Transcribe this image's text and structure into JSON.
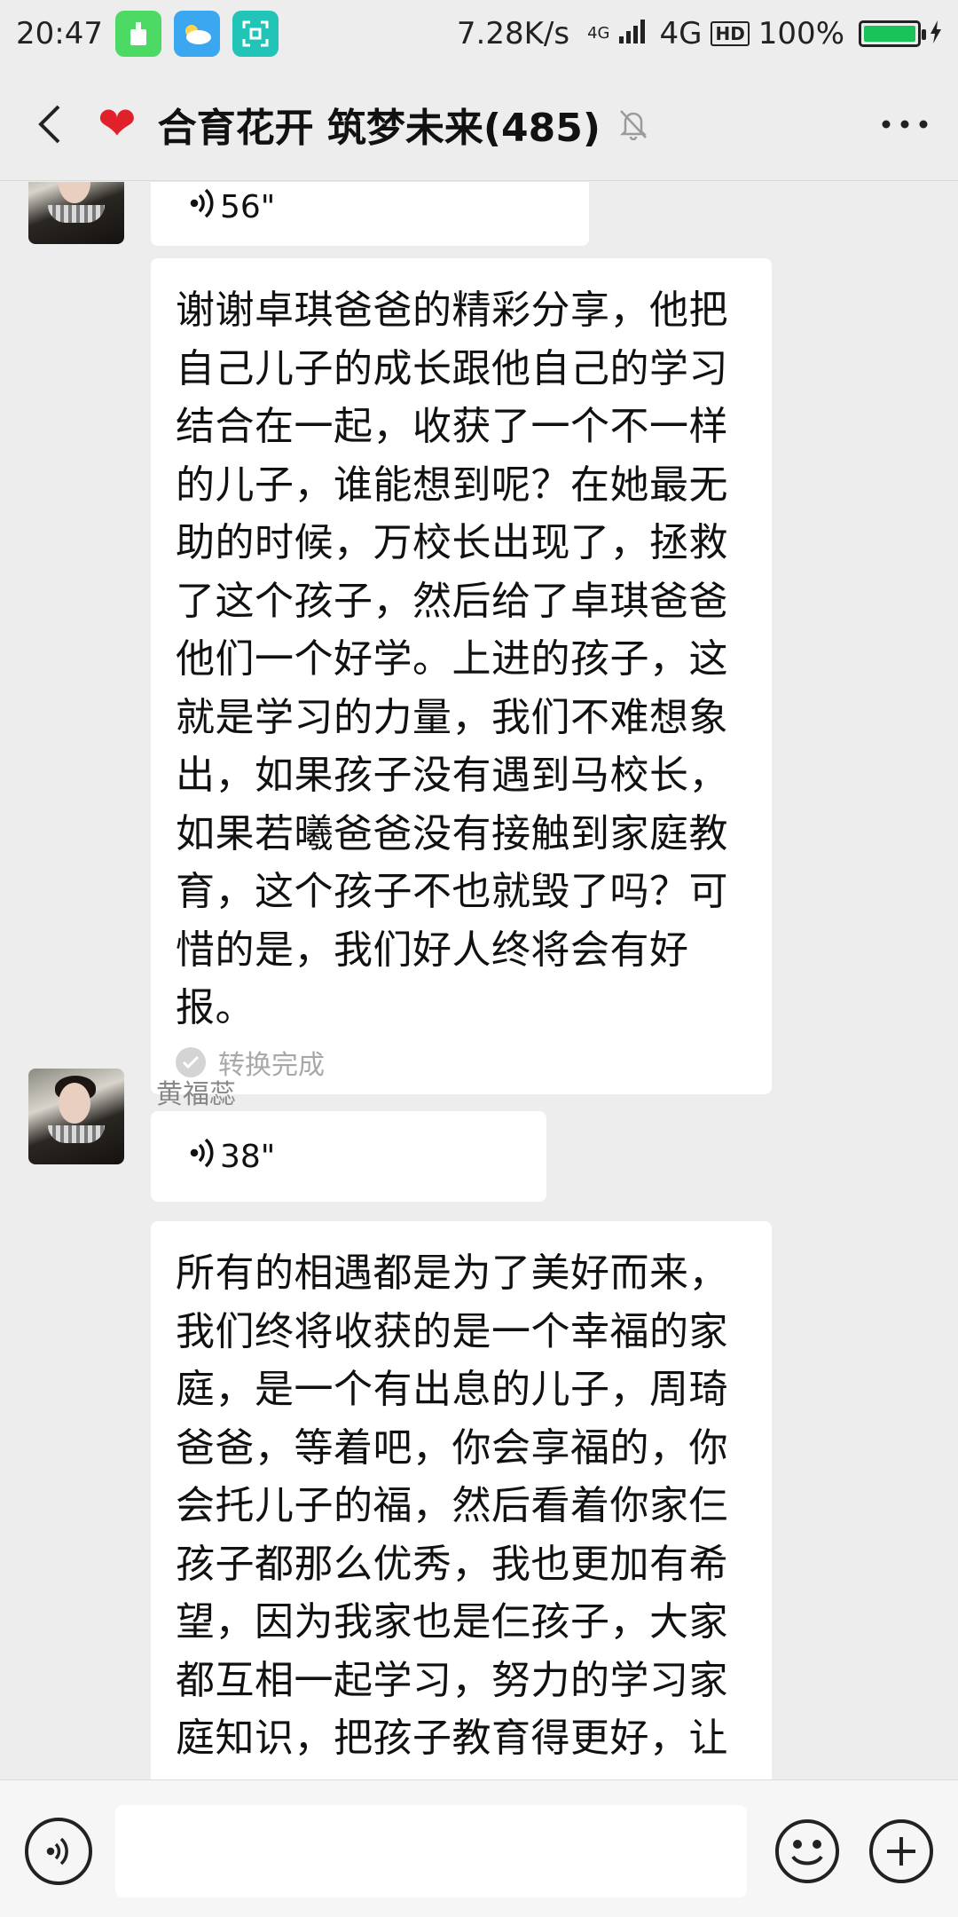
{
  "status_bar": {
    "time": "20:47",
    "net_speed": "7.28K/s",
    "network_small": "4G",
    "network": "4G",
    "hd": "HD",
    "battery": "100%",
    "battery_level": 1.0,
    "app_icons": [
      "cleaner-icon",
      "weather-icon",
      "scan-icon"
    ]
  },
  "header": {
    "title": "合育花开 筑梦未来(485)",
    "icons": [
      "back-arrow-icon",
      "heart-icon",
      "mute-bell-icon",
      "more-icon"
    ],
    "heart": "❤"
  },
  "messages": [
    {
      "type": "voice",
      "duration": "56\""
    },
    {
      "type": "text",
      "text": "谢谢卓琪爸爸的精彩分享，他把自己儿子的成长跟他自己的学习结合在一起，收获了一个不一样的儿子，谁能想到呢？在她最无助的时候，万校长出现了，拯救了这个孩子，然后给了卓琪爸爸他们一个好学。上进的孩子，这就是学习的力量，我们不难想象出，如果孩子没有遇到马校长，如果若曦爸爸没有接触到家庭教育，这个孩子不也就毁了吗？可惜的是，我们好人终将会有好报。",
      "status": "转换完成"
    },
    {
      "type": "voice",
      "sender": "黄福蕊",
      "duration": "38\""
    },
    {
      "type": "text",
      "text": "所有的相遇都是为了美好而来，我们终将收获的是一个幸福的家庭，是一个有出息的儿子，周琦爸爸，等着吧，你会享福的，你会托儿子的福，然后看着你家仨孩子都那么优秀，我也更加有希望，因为我家也是仨孩子，大家都互相一起学习，努力的学习家庭知识，把孩子教育得更好，让"
    }
  ],
  "input_bar": {
    "placeholder": "",
    "icons": [
      "voice-mode-icon",
      "emoji-icon",
      "plus-icon"
    ]
  }
}
